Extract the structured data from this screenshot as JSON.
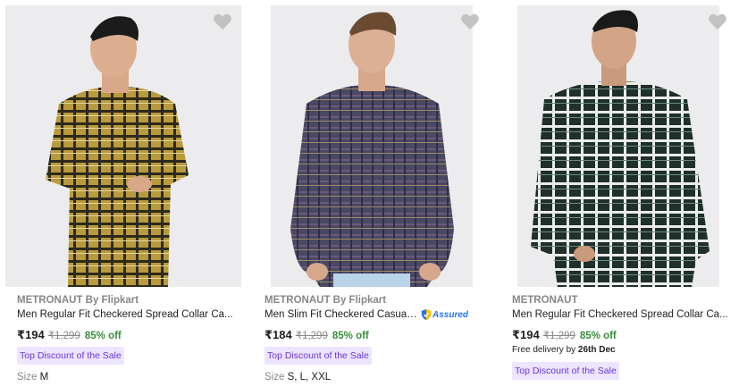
{
  "products": [
    {
      "brand": "METRONAUT By Flipkart",
      "title": "Men Regular Fit Checkered Spread Collar Ca...",
      "price": "₹194",
      "mrp": "₹1,299",
      "discount": "85% off",
      "badge": "Top Discount of the Sale",
      "size_label": "Size",
      "size_value": "M",
      "image_icon": "yellow-checkered-shirt-model",
      "wishlist_icon": "heart-icon"
    },
    {
      "brand": "METRONAUT By Flipkart",
      "title": "Men Slim Fit Checkered Casual ...",
      "assured": "Assured",
      "price": "₹184",
      "mrp": "₹1,299",
      "discount": "85% off",
      "badge": "Top Discount of the Sale",
      "size_label": "Size",
      "size_value": "S, L, XXL",
      "image_icon": "purple-checkered-shirt-model",
      "wishlist_icon": "heart-icon"
    },
    {
      "brand": "METRONAUT",
      "title": "Men Regular Fit Checkered Spread Collar Ca...",
      "price": "₹194",
      "mrp": "₹1,299",
      "discount": "85% off",
      "delivery_prefix": "Free delivery by",
      "delivery_date": "26th Dec",
      "badge": "Top Discount of the Sale",
      "image_icon": "green-white-checkered-shirt-model",
      "wishlist_icon": "heart-icon"
    }
  ],
  "colors": {
    "discount_green": "#388e3c",
    "badge_text": "#6b36d6",
    "badge_bg": "#ede4ff",
    "muted": "#878787",
    "assured_blue": "#2874f0"
  }
}
